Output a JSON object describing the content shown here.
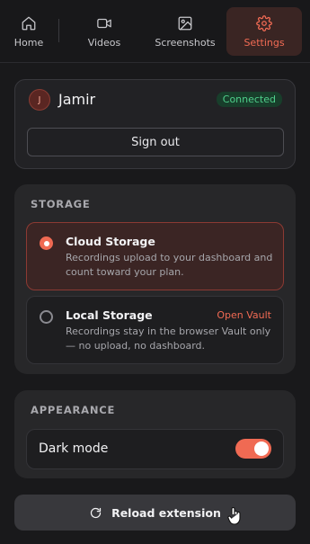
{
  "nav": {
    "tabs": [
      {
        "label": "Home",
        "icon": "home-icon"
      },
      {
        "label": "Videos",
        "icon": "video-camera-icon"
      },
      {
        "label": "Screenshots",
        "icon": "image-icon"
      },
      {
        "label": "Settings",
        "icon": "gear-icon",
        "active": true
      }
    ]
  },
  "account": {
    "initial": "J",
    "username": "Jamir",
    "status": "Connected",
    "signout_label": "Sign out"
  },
  "storage": {
    "title": "STORAGE",
    "selected": "cloud",
    "options": [
      {
        "title": "Cloud Storage",
        "description": "Recordings upload to your dashboard and count toward your plan."
      },
      {
        "title": "Local Storage",
        "description": "Recordings stay in the browser Vault only — no upload, no dashboard.",
        "link": "Open Vault"
      }
    ]
  },
  "appearance": {
    "title": "APPEARANCE",
    "dark_mode_label": "Dark mode",
    "dark_mode_on": true
  },
  "reload_label": "Reload extension",
  "colors": {
    "accent": "#f06a53",
    "background": "#19191b",
    "connected_text": "#4fcf8b"
  }
}
